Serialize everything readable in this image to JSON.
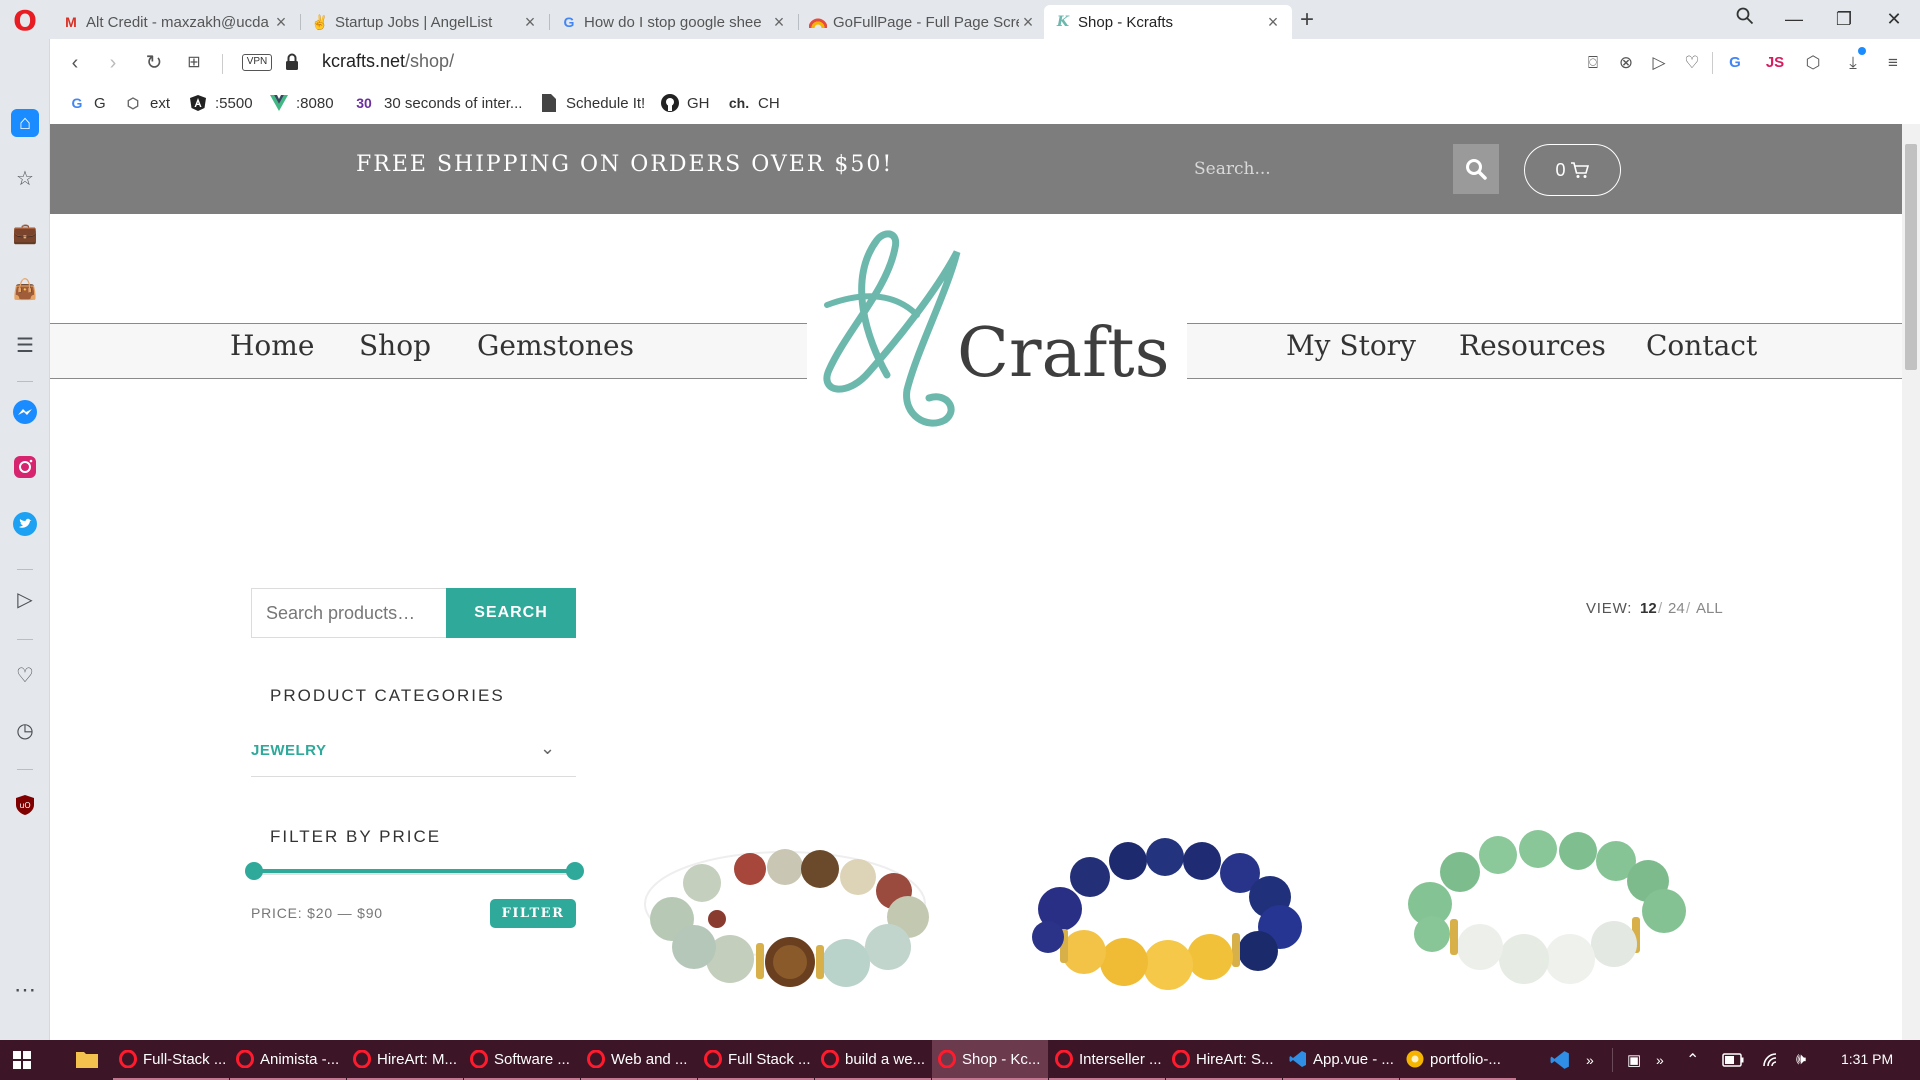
{
  "browser": {
    "tabs": [
      {
        "title": "Alt Credit - maxzakh@ucda",
        "icon": "gmail-icon"
      },
      {
        "title": "Startup Jobs | AngelList",
        "icon": "angellist-icon"
      },
      {
        "title": "How do I stop google shee",
        "icon": "google-icon"
      },
      {
        "title": "GoFullPage - Full Page Scre",
        "icon": "gofullpage-icon"
      },
      {
        "title": "Shop - Kcrafts",
        "icon": "kcrafts-icon",
        "active": true
      }
    ],
    "url_host": "kcrafts.net",
    "url_path": "/shop/",
    "vpn_label": "VPN",
    "bookmarks": [
      {
        "icon": "google-icon",
        "label": "G"
      },
      {
        "icon": "cube-icon",
        "label": "ext"
      },
      {
        "icon": "angular-icon",
        "label": ":5500"
      },
      {
        "icon": "vue-icon",
        "label": ":8080"
      },
      {
        "icon": "thirty-seconds-icon",
        "icon_text": "30",
        "label": "30 seconds of inter..."
      },
      {
        "icon": "document-icon",
        "label": "Schedule It!"
      },
      {
        "icon": "github-icon",
        "label": "GH"
      },
      {
        "icon": "ch-icon",
        "icon_text": "ch.",
        "label": "CH"
      }
    ]
  },
  "site": {
    "promo": "FREE SHIPPING ON ORDERS OVER $50!",
    "search_placeholder": "Search...",
    "cart_count": "0",
    "nav_left": [
      "Home",
      "Shop",
      "Gemstones"
    ],
    "nav_right": [
      "My Story",
      "Resources",
      "Contact"
    ],
    "logo_text": "Crafts",
    "logo_letter": "K"
  },
  "shop": {
    "product_search_placeholder": "Search products…",
    "search_button": "SEARCH",
    "categories_title": "PRODUCT CATEGORIES",
    "category_selected": "JEWELRY",
    "filter_title": "FILTER BY PRICE",
    "price_label": "PRICE: $20 — $90",
    "price_range": [
      20,
      90
    ],
    "filter_button": "FILTER",
    "view_label": "VIEW:",
    "view_options": [
      "12",
      "24",
      "ALL"
    ],
    "view_separator": "/",
    "products": [
      {
        "name": "amazonite-tigers-eye-bracelet"
      },
      {
        "name": "lapis-citrine-bracelet"
      },
      {
        "name": "aventurine-moonstone-bracelet"
      }
    ]
  },
  "taskbar": {
    "items": [
      {
        "label": "Full-Stack ...",
        "icon": "opera-icon"
      },
      {
        "label": "Animista -...",
        "icon": "opera-icon"
      },
      {
        "label": "HireArt: M...",
        "icon": "opera-icon"
      },
      {
        "label": "Software ...",
        "icon": "opera-icon"
      },
      {
        "label": "Web and ...",
        "icon": "opera-icon"
      },
      {
        "label": "Full Stack ...",
        "icon": "opera-icon"
      },
      {
        "label": "build a we...",
        "icon": "opera-icon"
      },
      {
        "label": "Shop - Kc...",
        "icon": "opera-icon",
        "active": true
      },
      {
        "label": "Interseller ...",
        "icon": "opera-icon"
      },
      {
        "label": "HireArt: S...",
        "icon": "opera-icon"
      },
      {
        "label": "App.vue - ...",
        "icon": "vscode-icon"
      },
      {
        "label": "portfolio-...",
        "icon": "chrome-canary-icon"
      }
    ],
    "time": "1:31 PM"
  },
  "colors": {
    "accent": "#2ea99a",
    "promo_band": "#7d7d7d",
    "logo_teal": "#6cb8ad",
    "taskbar": "#3c1626"
  }
}
